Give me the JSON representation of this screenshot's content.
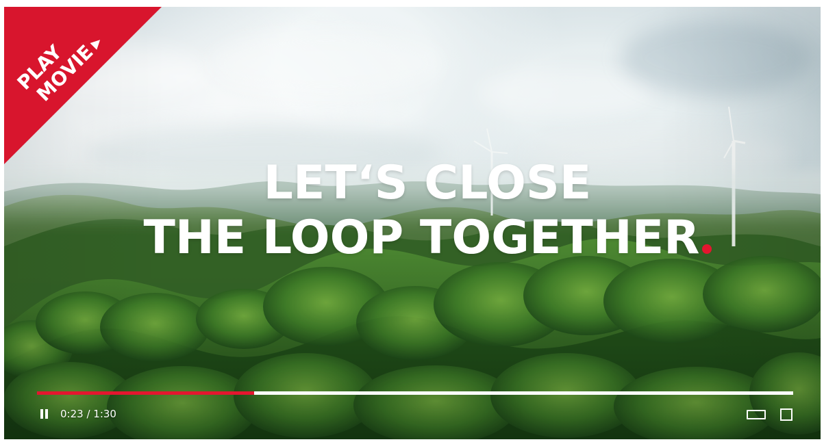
{
  "player": {
    "title_lines": [
      "LET‘S CLOSE",
      "THE LOOP TOGETHER"
    ],
    "accent_color": "#e4162f",
    "play_banner": {
      "line1": "PLAY",
      "line2": "MOVIE",
      "icon": "play-triangle-icon"
    },
    "controls": {
      "pause_icon": "pause-icon",
      "time": "0:23 / 1:30",
      "progress_fraction": 0.2868,
      "theater_icon": "theater-mode-icon",
      "fullscreen_icon": "fullscreen-icon"
    }
  }
}
